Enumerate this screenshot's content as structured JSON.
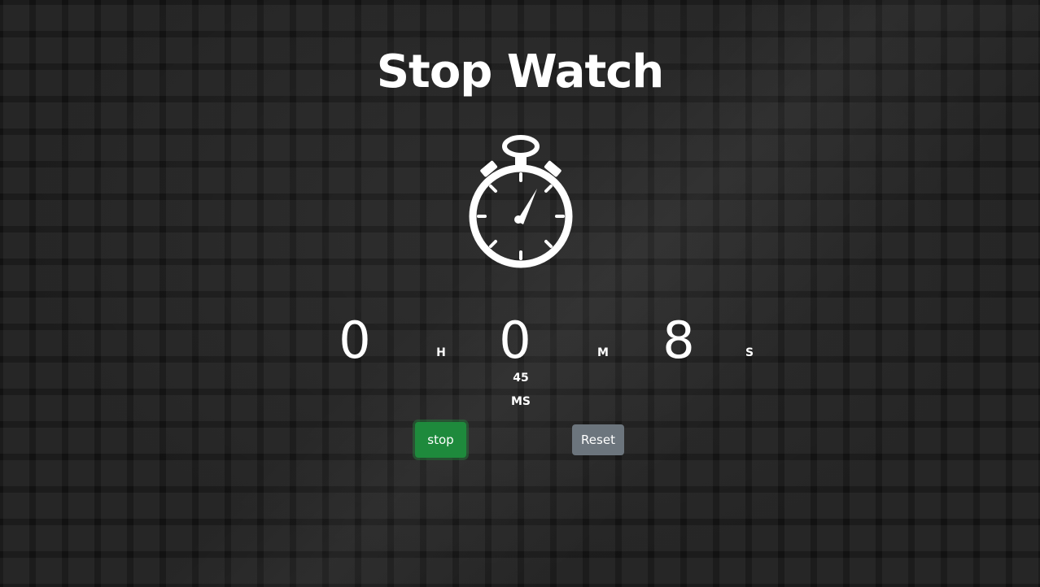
{
  "header": {
    "title": "Stop Watch"
  },
  "icon": {
    "name": "stopwatch-icon",
    "color": "#ffffff"
  },
  "timer": {
    "hours": "0",
    "hours_unit": "H",
    "minutes": "0",
    "minutes_unit": "M",
    "seconds": "8",
    "seconds_unit": "S",
    "milliseconds": "45",
    "milliseconds_unit": "MS"
  },
  "controls": {
    "stop_label": "stop",
    "stop_color": "#1e8a3c",
    "reset_label": "Reset",
    "reset_color": "#6c757d"
  }
}
